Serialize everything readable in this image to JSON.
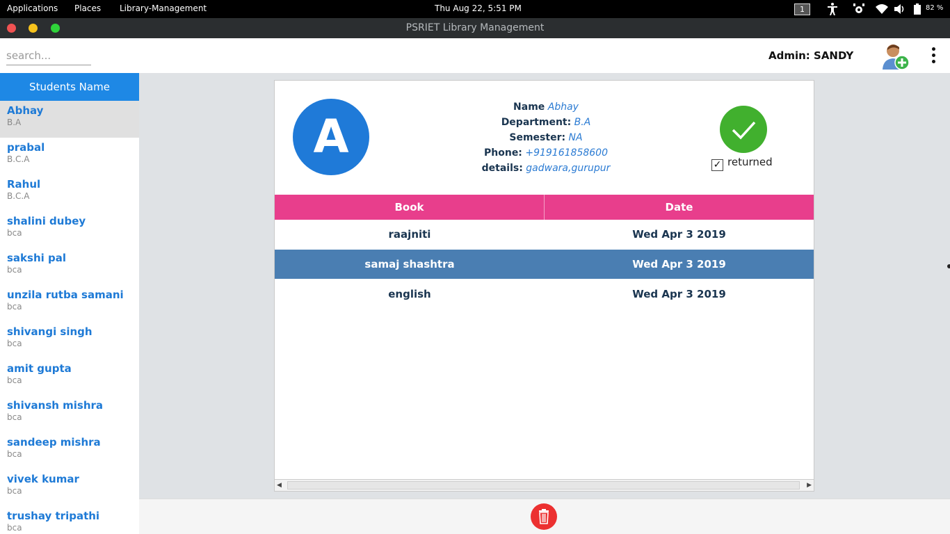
{
  "topbar": {
    "menus": [
      "Applications",
      "Places",
      "Library-Management"
    ],
    "clock": "Thu Aug 22,  5:51 PM",
    "workspace": "1",
    "battery": "82 %"
  },
  "window": {
    "title": "PSRIET Library Management"
  },
  "header": {
    "search_placeholder": "search...",
    "admin_label": "Admin: SANDY"
  },
  "sidebar": {
    "title": "Students Name",
    "students": [
      {
        "name": "Abhay",
        "dept": "B.A"
      },
      {
        "name": "prabal",
        "dept": "B.C.A"
      },
      {
        "name": "Rahul",
        "dept": "B.C.A"
      },
      {
        "name": "shalini dubey",
        "dept": "bca"
      },
      {
        "name": "sakshi pal",
        "dept": "bca"
      },
      {
        "name": "unzila rutba samani",
        "dept": "bca"
      },
      {
        "name": "shivangi singh",
        "dept": "bca"
      },
      {
        "name": "amit gupta",
        "dept": "bca"
      },
      {
        "name": "shivansh mishra",
        "dept": "bca"
      },
      {
        "name": "sandeep mishra",
        "dept": "bca"
      },
      {
        "name": "vivek kumar",
        "dept": "bca"
      },
      {
        "name": "trushay tripathi",
        "dept": "bca"
      }
    ]
  },
  "profile": {
    "avatar_letter": "A",
    "name_label": "Name",
    "name": "Abhay",
    "department_label": "Department:",
    "department": "B.A",
    "semester_label": "Semester:",
    "semester": "NA",
    "phone_label": "Phone:",
    "phone": "+919161858600",
    "details_label": "details:",
    "details": "gadwara,gurupur",
    "returned_label": "returned",
    "returned_check": "✓"
  },
  "table": {
    "headers": [
      "Book",
      "Date"
    ],
    "rows": [
      {
        "book": "raajniti",
        "date": "Wed Apr 3 2019"
      },
      {
        "book": "samaj shashtra",
        "date": "Wed Apr 3 2019"
      },
      {
        "book": "english",
        "date": "Wed Apr 3 2019"
      }
    ]
  },
  "colors": {
    "accent_blue": "#1e88e5",
    "table_header": "#e83e8c",
    "row_selected": "#4a7eb2",
    "returned_green": "#41b02e",
    "delete_red": "#ec3030"
  },
  "icons": [
    "accessibility-icon",
    "settings-icon",
    "wifi-icon",
    "volume-icon",
    "battery-icon",
    "add-user-icon",
    "more-vert-icon",
    "check-icon",
    "trash-icon"
  ]
}
